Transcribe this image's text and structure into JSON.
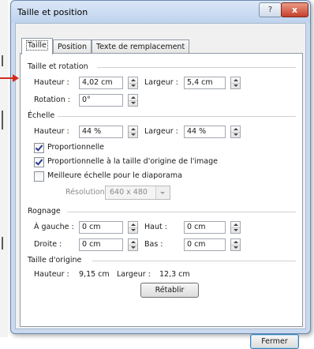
{
  "window": {
    "title": "Taille et position",
    "help_glyph": "?",
    "close_glyph": "x"
  },
  "tabs": [
    {
      "label": "Taille"
    },
    {
      "label": "Position"
    },
    {
      "label": "Texte de remplacement"
    }
  ],
  "size_rotation": {
    "header": "Taille et rotation",
    "height_label": "Hauteur :",
    "height_value": "4,02 cm",
    "width_label": "Largeur :",
    "width_value": "5,4 cm",
    "rotation_label": "Rotation :",
    "rotation_value": "0°"
  },
  "scale": {
    "header": "Échelle",
    "height_label": "Hauteur :",
    "height_value": "44 %",
    "width_label": "Largeur :",
    "width_value": "44 %",
    "lock_aspect": {
      "label": "Proportionnelle",
      "checked": true
    },
    "relative_original": {
      "label": "Proportionnelle à la taille d'origine de l'image",
      "checked": true
    },
    "best_scale": {
      "label": "Meilleure échelle pour le diaporama",
      "checked": false
    },
    "resolution_label": "Résolution",
    "resolution_value": "640 x 480"
  },
  "crop": {
    "header": "Rognage",
    "left_label": "À gauche :",
    "left_value": "0 cm",
    "top_label": "Haut :",
    "top_value": "0 cm",
    "right_label": "Droite :",
    "right_value": "0 cm",
    "bottom_label": "Bas :",
    "bottom_value": "0 cm"
  },
  "original_size": {
    "header": "Taille d'origine",
    "height_label": "Hauteur :",
    "height_value": "9,15 cm",
    "width_label": "Largeur :",
    "width_value": "12,3 cm",
    "reset_label": "Rétablir"
  },
  "footer": {
    "close_label": "Fermer"
  },
  "colors": {
    "annotation_arrow": "#d42a1a",
    "title_bg": "#c9daf0",
    "close_button": "#c6402b"
  }
}
